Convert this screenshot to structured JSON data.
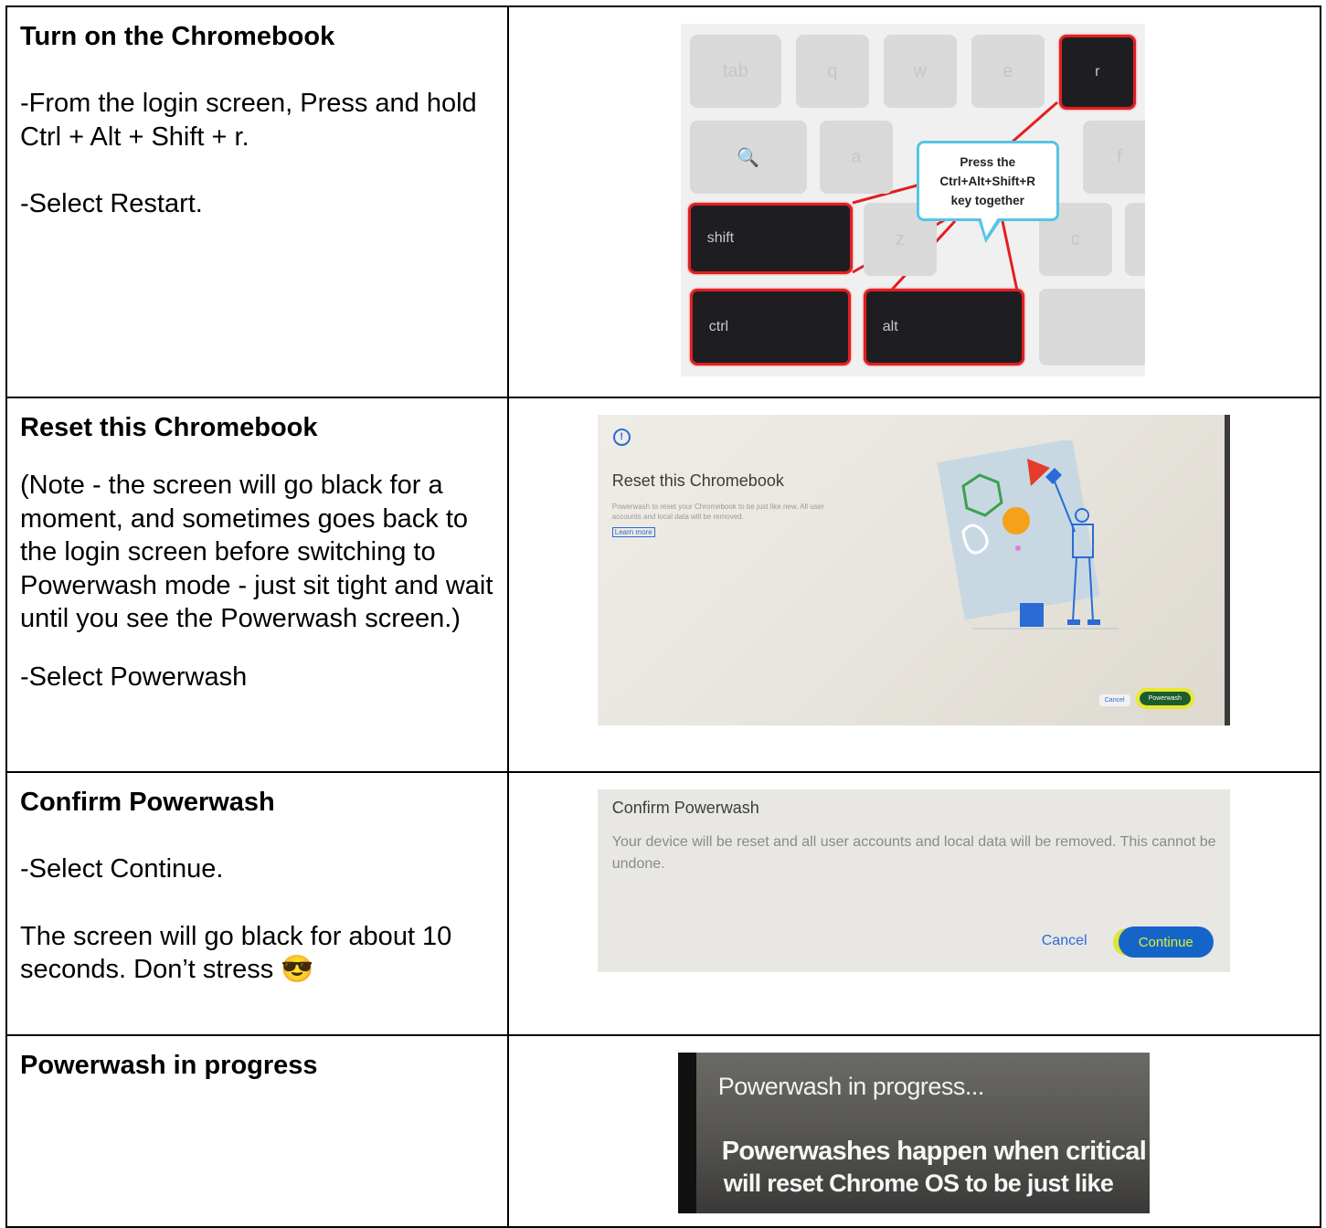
{
  "rows": [
    {
      "heading": "Turn on the Chromebook",
      "lines": [
        "-From the login screen, Press and hold Ctrl + Alt + Shift + r.",
        "-Select Restart."
      ]
    },
    {
      "heading": "Reset this Chromebook",
      "note": "(Note - the screen will go black for a moment, and sometimes goes back to the login screen before switching to Powerwash mode - just sit tight and wait until you see the Powerwash screen.)",
      "action": "-Select Powerwash"
    },
    {
      "heading": "Confirm Powerwash",
      "action": "-Select Continue.",
      "note": "The screen will go black for about 10 seconds. Don’t stress 😎"
    },
    {
      "heading": "Powerwash in progress"
    }
  ],
  "keyboard_image": {
    "keys": {
      "tab": "tab",
      "q": "q",
      "w": "w",
      "e": "e",
      "r": "r",
      "search": "🔍",
      "a": "a",
      "f": "f",
      "shift": "shift",
      "z": "z",
      "c": "c",
      "ctrl": "ctrl",
      "alt": "alt"
    },
    "callout_lines": [
      "Press the",
      "Ctrl+Alt+Shift+R",
      "key together"
    ],
    "highlight_color": "#e02020",
    "callout_border_color": "#56c5e6"
  },
  "reset_screen": {
    "title": "Reset this Chromebook",
    "body": "Powerwash to reset your Chromebook to be just like new. All user accounts and local data will be removed.",
    "learn_more": "Learn more",
    "cancel": "Cancel",
    "powerwash": "Powerwash"
  },
  "confirm_screen": {
    "title": "Confirm Powerwash",
    "body": "Your device will be reset and all user accounts and local data will be removed. This cannot be undone.",
    "cancel": "Cancel",
    "continue": "Continue"
  },
  "progress_screen": {
    "title": "Powerwash in progress...",
    "line1": "Powerwashes happen when critical",
    "line2": "will reset Chrome OS to be just like"
  }
}
